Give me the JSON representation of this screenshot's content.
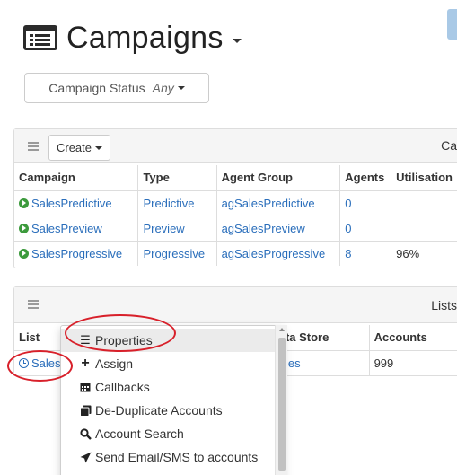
{
  "header": {
    "title": "Campaigns"
  },
  "filter": {
    "label": "Campaign Status",
    "value": "Any"
  },
  "campaigns_panel": {
    "create_label": "Create",
    "heading_right": "Ca",
    "columns": [
      "Campaign",
      "Type",
      "Agent Group",
      "Agents",
      "Utilisation"
    ],
    "rows": [
      {
        "campaign": "SalesPredictive",
        "type": "Predictive",
        "agent_group": "agSalesPredictive",
        "agents": "0",
        "utilisation": ""
      },
      {
        "campaign": "SalesPreview",
        "type": "Preview",
        "agent_group": "agSalesPreview",
        "agents": "0",
        "utilisation": ""
      },
      {
        "campaign": "SalesProgressive",
        "type": "Progressive",
        "agent_group": "agSalesProgressive",
        "agents": "8",
        "utilisation": "96%"
      }
    ]
  },
  "lists_panel": {
    "heading_right": "Lists",
    "columns": {
      "list": "List",
      "data_store": "ata Store",
      "accounts": "Accounts"
    },
    "row": {
      "list": "Sales",
      "data_store": "ales",
      "accounts": "999"
    }
  },
  "menu": {
    "items": [
      {
        "label": "Properties",
        "icon": "list-icon"
      },
      {
        "label": "Assign",
        "icon": "plus-icon"
      },
      {
        "label": "Callbacks",
        "icon": "calendar-icon"
      },
      {
        "label": "De-Duplicate Accounts",
        "icon": "copy-icon"
      },
      {
        "label": "Account Search",
        "icon": "search-icon"
      },
      {
        "label": "Send Email/SMS to accounts",
        "icon": "send-icon"
      }
    ]
  },
  "colors": {
    "link": "#2a6ebb",
    "annotation": "#d8202a",
    "play": "#3c9a3c"
  }
}
